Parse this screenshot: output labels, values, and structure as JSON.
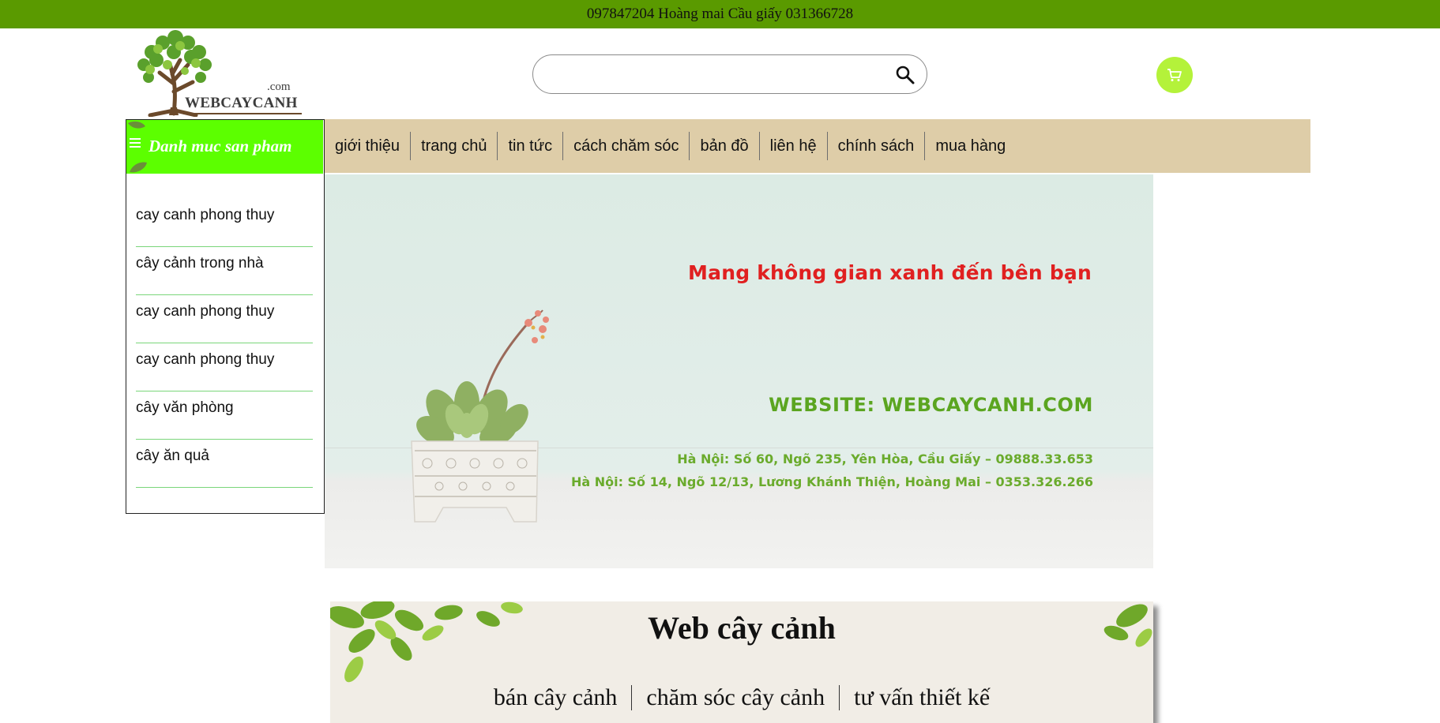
{
  "topbar": {
    "text": "097847204 Hoàng mai Cầu giấy 031366728"
  },
  "logo": {
    "name": "WEBCAYCANH",
    "suffix": ".com"
  },
  "search": {
    "placeholder": "",
    "value": ""
  },
  "category": {
    "title": "Danh muc san pham",
    "items": [
      "cay canh phong thuy",
      "cây cảnh trong nhà",
      "cay canh phong thuy",
      "cay canh phong thuy",
      "cây văn phòng",
      "cây ăn quả"
    ]
  },
  "nav": {
    "items": [
      "giới thiệu",
      "trang chủ",
      "tin tức",
      "cách chăm sóc",
      "bản đồ",
      "liên hệ",
      "chính sách",
      "mua hàng"
    ]
  },
  "banner": {
    "slogan": "Mang không gian xanh đến bên bạn",
    "website": "WEBSITE: WEBCAYCANH.COM",
    "address1": "Hà Nội: Số 60, Ngõ 235, Yên Hòa, Cầu Giấy  –  09888.33.653",
    "address2": "Hà Nội: Số 14, Ngõ 12/13, Lương Khánh Thiện, Hoàng Mai  –  0353.326.266"
  },
  "about": {
    "title": "Web cây cảnh",
    "links": [
      "bán cây cảnh",
      "chăm sóc cây cảnh",
      "tư vấn thiết kế"
    ]
  },
  "colors": {
    "topbar": "#5a9a00",
    "category_header": "#5cff00",
    "nav_bg": "#decda8",
    "cart": "#b4f23a",
    "slogan": "#e02020",
    "website": "#5ba520"
  }
}
